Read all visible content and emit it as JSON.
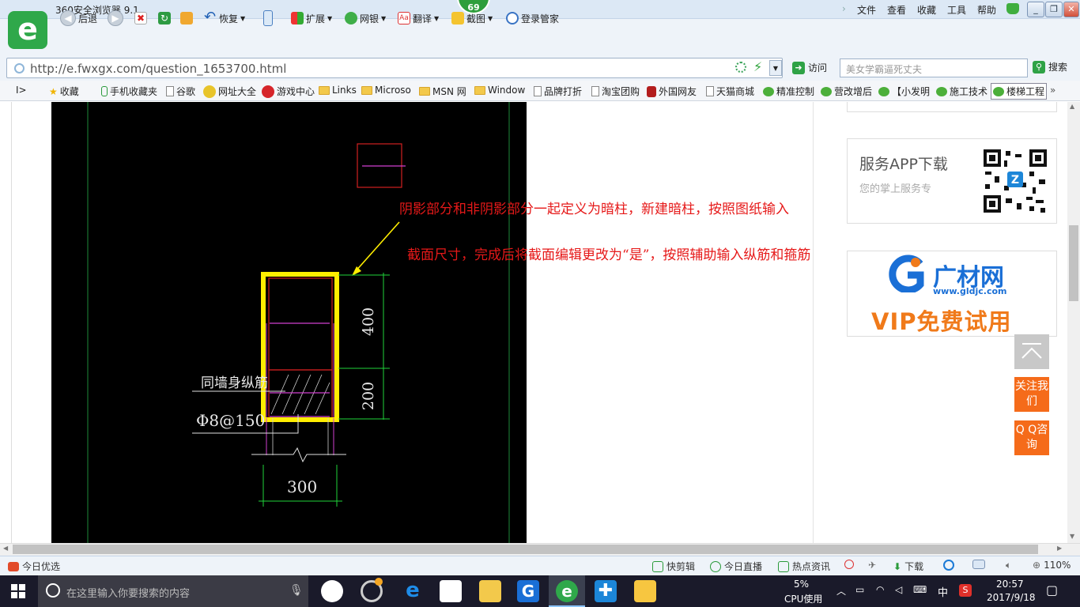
{
  "window": {
    "title": "360安全浏览器 9.1",
    "badge": "69",
    "menus": [
      "文件",
      "查看",
      "收藏",
      "工具",
      "帮助"
    ]
  },
  "toolbar": {
    "back": "后退",
    "restore": "恢复",
    "extend": "扩展",
    "bank": "网银",
    "translate": "翻译",
    "screenshot": "截图",
    "login": "登录管家"
  },
  "address": {
    "url": "http://e.fwxgx.com/question_1653700.html",
    "visit": "访问",
    "search_placeholder": "美女学霸逼死丈夫",
    "search": "搜索"
  },
  "favorites": [
    "收藏",
    "手机收藏夹",
    "谷歌",
    "网址大全",
    "游戏中心",
    "Links",
    "Microso",
    "MSN 网",
    "Window",
    "品牌打折",
    "淘宝团购",
    "外国网友",
    "天猫商城",
    "精准控制",
    "营改增后",
    "【小发明",
    "施工技术",
    "楼梯工程"
  ],
  "drawing": {
    "label_wall": "同墙身纵筋",
    "label_stirrup": "Φ8@150",
    "dim_400": "400",
    "dim_200": "200",
    "dim_300": "300"
  },
  "annotation": {
    "line1": "阴影部分和非阴影部分一起定义为暗柱，新建暗柱，按照图纸输入",
    "line2": "截面尺寸，完成后将截面编辑更改为“是”，按照辅助输入纵筋和箍筋"
  },
  "sidebar": {
    "app_title": "服务APP下载",
    "app_sub": "您的掌上服务专",
    "gc_name": "广材网",
    "gc_url": "www.gldjc.com",
    "gc_vip": "VIP免费试用",
    "follow": "关注我们",
    "qq": "Q Q咨询"
  },
  "status": {
    "left": "今日优选",
    "quick": "快剪辑",
    "live": "今日直播",
    "hot": "热点资讯",
    "download": "下载",
    "zoom": "110%"
  },
  "taskbar": {
    "search": "在这里输入你要搜索的内容",
    "cpu_pct": "5%",
    "cpu_label": "CPU使用",
    "ime": "中",
    "time": "20:57",
    "date": "2017/9/18"
  },
  "colors": {
    "annotation_red": "#e61919",
    "highlight_yellow": "#ffee00",
    "orange": "#f56b1a",
    "gc_blue": "#1a6fd6"
  }
}
